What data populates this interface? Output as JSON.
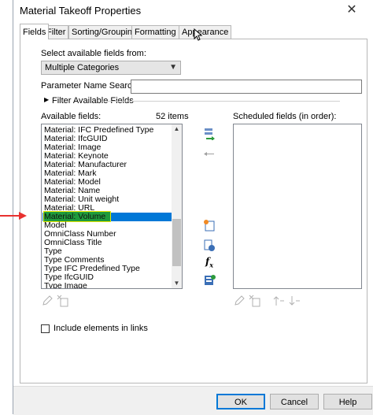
{
  "window": {
    "title": "Material Takeoff Properties",
    "close_glyph": "✕"
  },
  "tabs": [
    "Fields",
    "Filter",
    "Sorting/Grouping",
    "Formatting",
    "Appearance"
  ],
  "fields_tab": {
    "select_label": "Select available fields from:",
    "category_value": "Multiple Categories",
    "param_search_label": "Parameter Name Search:",
    "param_search_value": "",
    "filter_label": "Filter Available Fields",
    "available_label": "Available fields:",
    "available_count": "52 items",
    "available_items": [
      "Material: IFC Predefined Type",
      "Material: IfcGUID",
      "Material: Image",
      "Material: Keynote",
      "Material: Manufacturer",
      "Material: Mark",
      "Material: Model",
      "Material: Name",
      "Material: Unit weight",
      "Material: URL",
      "Material: Volume",
      "Model",
      "OmniClass Number",
      "OmniClass Title",
      "Type",
      "Type Comments",
      "Type IFC Predefined Type",
      "Type IfcGUID",
      "Type Image"
    ],
    "selected_item": "Material: Volume",
    "scheduled_label": "Scheduled fields (in order):",
    "scheduled_items": [],
    "include_links_label": "Include elements in links",
    "include_links_checked": false
  },
  "buttons": {
    "ok": "OK",
    "cancel": "Cancel",
    "help": "Help"
  },
  "colors": {
    "selection": "#0078d7",
    "highlight": "#1f9b3c",
    "annotation_arrow": "#e8312f"
  }
}
